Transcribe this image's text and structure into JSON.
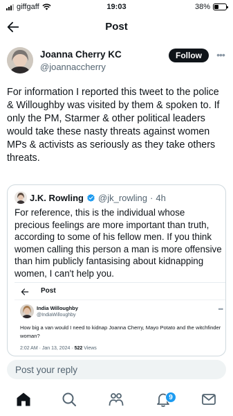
{
  "status_bar": {
    "carrier": "giffgaff",
    "time": "19:03",
    "battery": "38%",
    "battery_level": 0.38
  },
  "header": {
    "title": "Post",
    "back_icon": "arrow-left-icon"
  },
  "author": {
    "name": "Joanna Cherry KC",
    "handle": "@joannaccherry",
    "follow_label": "Follow",
    "more_icon": "more-horizontal-icon"
  },
  "tweet": {
    "text": "For information I reported this tweet to the police & Willoughby was visited by them & spoken to. If only the PM, Starmer & other political leaders would take these nasty threats against women MPs & activists as seriously as they take others threats."
  },
  "quoted": {
    "name": "J.K. Rowling",
    "handle": "@jk_rowling",
    "separator": "·",
    "time": "4h",
    "text": "For reference, this is the individual whose precious feelings are more important than truth, according to some of his fellow men. If you think women calling this person a man is more offensive than him publicly fantasising about kidnapping women, I can't help you.",
    "screenshot": {
      "title": "Post",
      "name": "India Willoughby",
      "handle": "@IndiaWilloughby",
      "text": "How big a van would I need to kidnap Joanna Cherry, Mayo Potato and the witchfinder woman?",
      "meta": "2:02 AM · Jan 13, 2024 · ",
      "views_count": "522",
      "views_label": " Views"
    }
  },
  "reply": {
    "placeholder": "Post your reply"
  },
  "nav": {
    "items": [
      "home-icon",
      "search-icon",
      "communities-icon",
      "notifications-icon",
      "messages-icon"
    ],
    "notification_count": "9"
  },
  "colors": {
    "accent": "#1d9bf0",
    "text": "#0f1419",
    "secondary": "#536471"
  }
}
